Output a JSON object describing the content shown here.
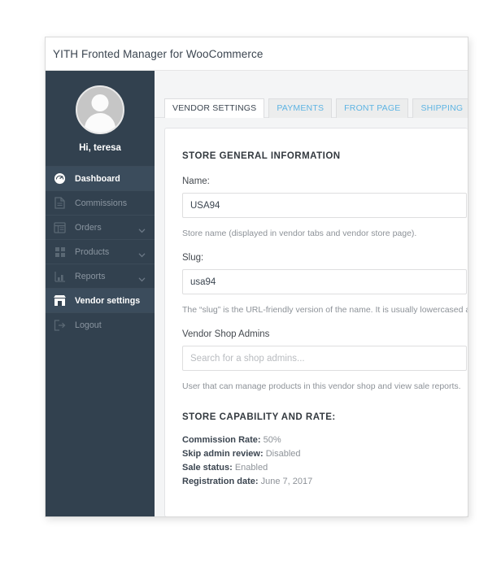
{
  "window": {
    "title": "YITH Fronted Manager for WooCommerce"
  },
  "colors": {
    "sidebar_bg": "#32414f",
    "sidebar_active_bg": "#3b4c5c",
    "tab_link": "#5eb4e3",
    "page_bg": "#ffffff",
    "content_bg": "#f4f5f6"
  },
  "sidebar": {
    "greeting": "Hi, teresa",
    "avatar_icon": "user-avatar-icon",
    "items": [
      {
        "label": "Dashboard",
        "icon": "dashboard-icon",
        "active": true,
        "chevron": false
      },
      {
        "label": "Commissions",
        "icon": "document-icon",
        "active": false,
        "chevron": false
      },
      {
        "label": "Orders",
        "icon": "list-icon",
        "active": false,
        "chevron": true
      },
      {
        "label": "Products",
        "icon": "grid-icon",
        "active": false,
        "chevron": true
      },
      {
        "label": "Reports",
        "icon": "bar-chart-icon",
        "active": false,
        "chevron": true
      },
      {
        "label": "Vendor settings",
        "icon": "store-icon",
        "active": true,
        "chevron": false
      },
      {
        "label": "Logout",
        "icon": "logout-icon",
        "active": false,
        "chevron": false
      }
    ]
  },
  "tabs": [
    {
      "label": "VENDOR SETTINGS",
      "active": true
    },
    {
      "label": "PAYMENTS",
      "active": false
    },
    {
      "label": "FRONT PAGE",
      "active": false
    },
    {
      "label": "SHIPPING",
      "active": false
    }
  ],
  "main": {
    "store_general_heading": "STORE GENERAL INFORMATION",
    "name_label": "Name:",
    "name_value": "USA94",
    "name_help": "Store name (displayed in vendor tabs and vendor store page).",
    "slug_label": "Slug:",
    "slug_value": "usa94",
    "slug_help": "The “slug” is the URL-friendly version of the name. It is usually lowercased and cont",
    "admins_label": "Vendor Shop Admins",
    "admins_value": "",
    "admins_placeholder": "Search for a shop admins...",
    "admins_help": "User that can manage products in this vendor shop and view sale reports.",
    "capability_heading": "STORE CAPABILITY AND RATE:",
    "capability": [
      {
        "label": "Commission Rate:",
        "value": "50%"
      },
      {
        "label": "Skip admin review:",
        "value": "Disabled"
      },
      {
        "label": "Sale status:",
        "value": "Enabled"
      },
      {
        "label": "Registration date:",
        "value": "June 7, 2017"
      }
    ]
  }
}
